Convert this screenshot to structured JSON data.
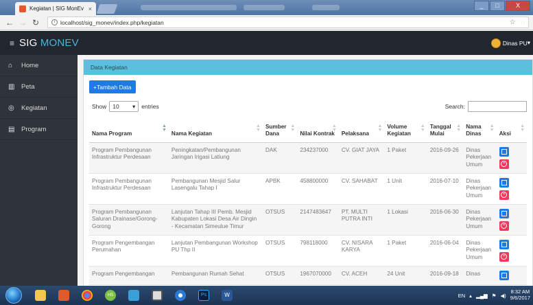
{
  "browser": {
    "tab_title": "Kegiatan | SIG MonEv",
    "tab_close": "×",
    "url": "localhost/sig_monev/index.php/kegiatan",
    "window_controls": [
      "_",
      "□",
      "X"
    ]
  },
  "header": {
    "brand_main": "SIG ",
    "brand_accent": "MONEV",
    "user_name": "Dinas PU",
    "user_caret": "▾"
  },
  "sidebar": {
    "items": [
      {
        "label": "Home",
        "icon": "home-icon",
        "glyph": "⌂"
      },
      {
        "label": "Peta",
        "icon": "map-icon",
        "glyph": "▥"
      },
      {
        "label": "Kegiatan",
        "icon": "target-icon",
        "glyph": "◎"
      },
      {
        "label": "Program",
        "icon": "document-icon",
        "glyph": "▤"
      }
    ]
  },
  "panel": {
    "title": "Data Kegiatan",
    "add_button": "+Tambah Data",
    "show_label": "Show",
    "entries_value": "10",
    "entries_label": "entries",
    "search_label": "Search:"
  },
  "table": {
    "headers": [
      "Nama Program",
      "Nama Kegiatan",
      "Sumber Dana",
      "Nilai Kontrak",
      "Pelaksana",
      "Volume Kegiatan",
      "Tanggal Mulai",
      "Nama Dinas",
      "Aksi"
    ],
    "rows": [
      {
        "program": "Program Pembangunan Infrastruktur Perdesaan",
        "kegiatan": "Peningkatan/Pembangunan Jaringan Irigasi Latiung",
        "sumber": "DAK",
        "nilai": "234237000",
        "pelaksana": "CV. GIAT JAYA",
        "volume": "1 Paket",
        "tanggal": "2016-09-26",
        "dinas": "Dinas Pekerjaan Umum"
      },
      {
        "program": "Program Pembangunan Infrastruktur Perdesaan",
        "kegiatan": "Pembangunan Mesjid Salur Lasengalu Tahap I",
        "sumber": "APBK",
        "nilai": "458800000",
        "pelaksana": "CV. SAHABAT",
        "volume": "1 Unit",
        "tanggal": "2016-07-10",
        "dinas": "Dinas Pekerjaan Umum"
      },
      {
        "program": "Program Pembangunan Saluran Drainase/Gorong-Gorong",
        "kegiatan": "Lanjutan Tahap III Pemb. Mesjid Kabupaten Lokasi Desa Air Dingin - Kecamatan Simeulue Timur",
        "sumber": "OTSUS",
        "nilai": "2147483647",
        "pelaksana": "PT. MULTI PUTRA INTI",
        "volume": "1 Lokasi",
        "tanggal": "2016-06-30",
        "dinas": "Dinas Pekerjaan Umum"
      },
      {
        "program": "Program Pengembangan Perumahan",
        "kegiatan": "Lanjutan Pembangunan Workshop PU Thp II",
        "sumber": "OTSUS",
        "nilai": "798118000",
        "pelaksana": "CV. NISARA KARYA",
        "volume": "1 Paket",
        "tanggal": "2016-06-04",
        "dinas": "Dinas Pekerjaan Umum"
      },
      {
        "program": "Program Pengembangan",
        "kegiatan": "Pembangunan Rumah Sehat",
        "sumber": "OTSUS",
        "nilai": "1967070000",
        "pelaksana": "CV. ACEH",
        "volume": "24 Unit",
        "tanggal": "2016-09-18",
        "dinas": "Dinas"
      }
    ]
  },
  "taskbar": {
    "lang": "EN",
    "time": "8:32 AM",
    "date": "9/6/2017",
    "apps": [
      "folder-icon",
      "xampp-icon",
      "chrome-icon",
      "hs-icon",
      "network-icon",
      "window-icon",
      "browser-icon",
      "photoshop-icon",
      "word-icon"
    ],
    "ps_label": "Ps",
    "w_label": "W",
    "hs_label": "HS"
  },
  "colors": {
    "panel_head": "#5bc0de",
    "primary": "#1e7be5",
    "danger": "#ef3a5d",
    "sidebar": "#2f343b",
    "header": "#22262e"
  }
}
